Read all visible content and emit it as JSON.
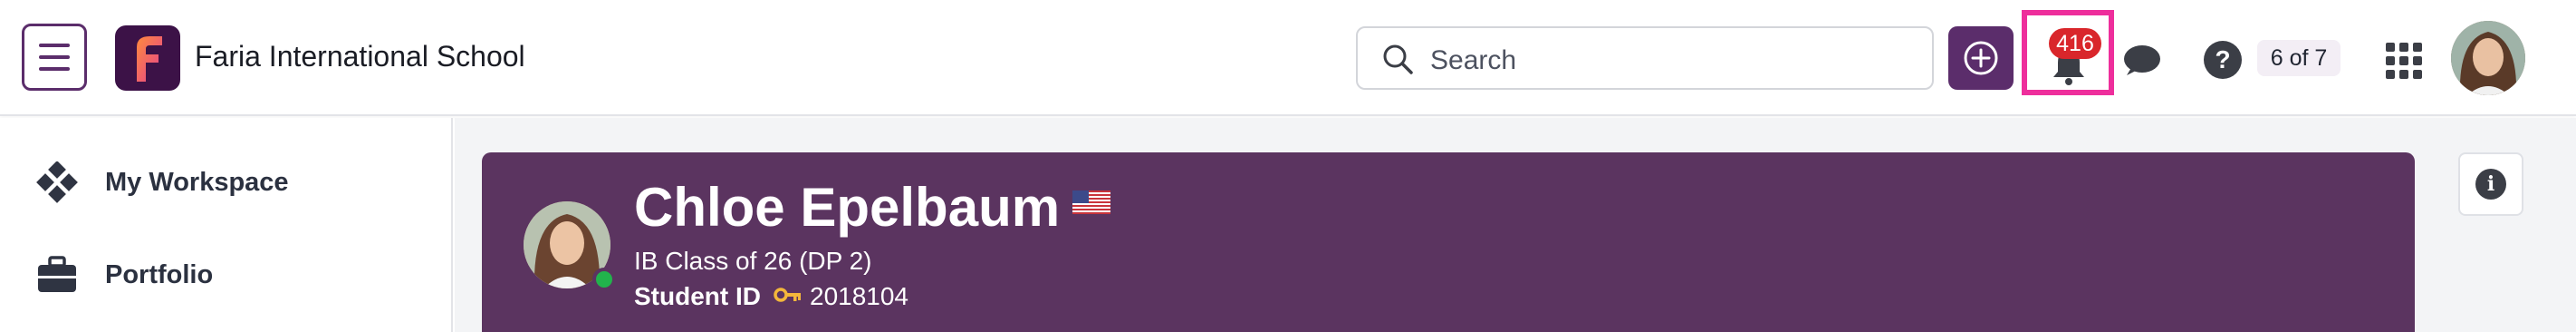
{
  "header": {
    "school_name": "Faria International School",
    "search": {
      "placeholder": "Search"
    },
    "notifications": {
      "count": "416"
    },
    "page_counter": "6 of 7",
    "icons": {
      "menu": "hamburger-icon",
      "logo": "faria-logo",
      "search": "search-icon",
      "add": "plus-circle-icon",
      "bell": "bell-icon",
      "chat": "chat-bubble-icon",
      "help": "question-icon",
      "apps": "grid-icon",
      "avatar": "user-avatar"
    },
    "colors": {
      "brand": "#5b2d6b",
      "highlight": "#ee2e9c",
      "badge": "#d9262b"
    }
  },
  "sidebar": {
    "items": [
      {
        "label": "My Workspace",
        "icon": "workspace-diamond-icon"
      },
      {
        "label": "Portfolio",
        "icon": "briefcase-icon"
      }
    ]
  },
  "profile": {
    "name": "Chloe Epelbaum",
    "class": "IB Class of 26 (DP 2)",
    "student_id_label": "Student ID",
    "student_id": "2018104",
    "flag": "us-flag",
    "status": "online",
    "card_color": "#5b3460"
  }
}
